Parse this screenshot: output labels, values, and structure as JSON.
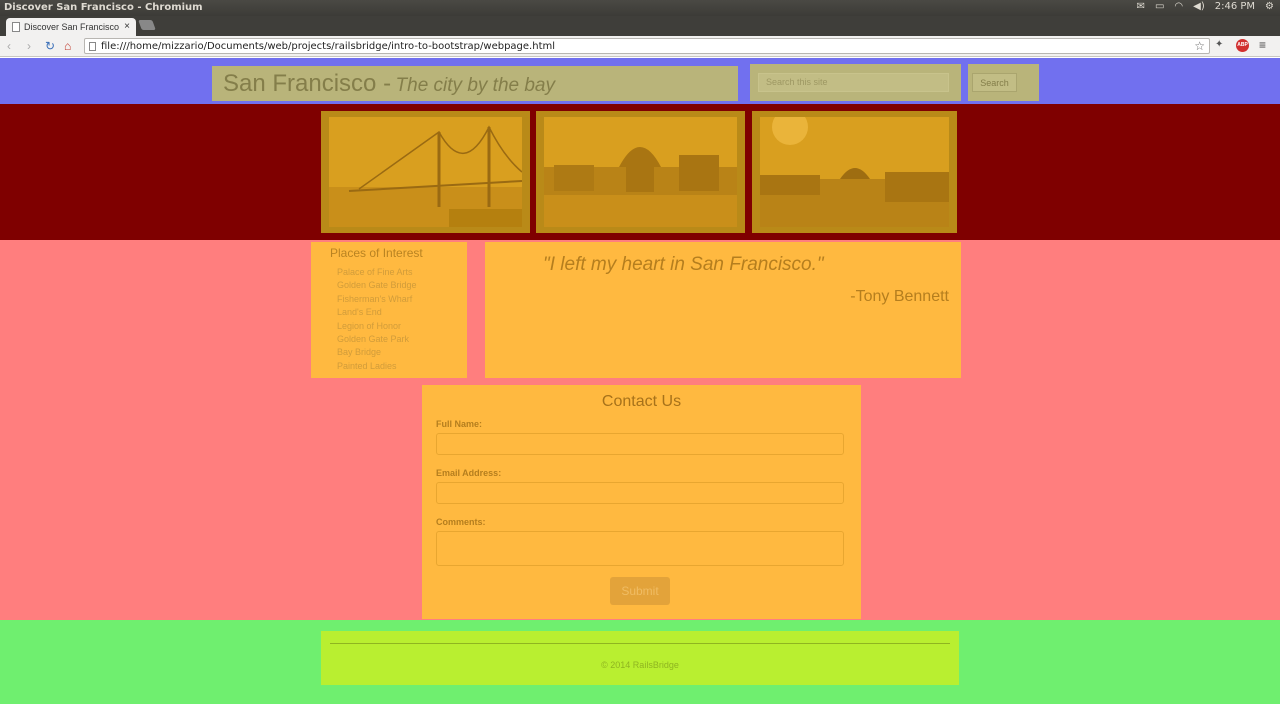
{
  "window": {
    "title": "Discover San Francisco - Chromium"
  },
  "system_tray": {
    "clock": "2:46 PM"
  },
  "tab": {
    "title": "Discover San Francisco",
    "close": "×"
  },
  "address_bar": {
    "url": "file:///home/mizzario/Documents/web/projects/railsbridge/intro-to-bootstrap/webpage.html"
  },
  "header": {
    "title": "San Francisco -",
    "tagline": "The city by the bay",
    "search_placeholder": "Search this site",
    "search_button": "Search"
  },
  "photos": [
    {
      "name": "bay-bridge-photo"
    },
    {
      "name": "palace-of-fine-arts-photo"
    },
    {
      "name": "lands-end-photo"
    }
  ],
  "places": {
    "title": "Places of Interest",
    "items": [
      "Palace of Fine Arts",
      "Golden Gate Bridge",
      "Fisherman's Wharf",
      "Land's End",
      "Legion of Honor",
      "Golden Gate Park",
      "Bay Bridge",
      "Painted Ladies"
    ]
  },
  "quote": {
    "text": "\"I left my heart in San Francisco.\"",
    "author": "-Tony Bennett"
  },
  "contact": {
    "title": "Contact Us",
    "full_name_label": "Full Name:",
    "email_label": "Email Address:",
    "comments_label": "Comments:",
    "submit": "Submit"
  },
  "footer": {
    "copyright": "© 2014 RailsBridge"
  },
  "colors": {
    "header_band": "#7170ef",
    "hero_band": "#7f0000",
    "main_band": "#ff7e7e",
    "panel": "#ffb940",
    "footer_band": "#6fef6f",
    "footer_panel": "#b9ef30"
  }
}
